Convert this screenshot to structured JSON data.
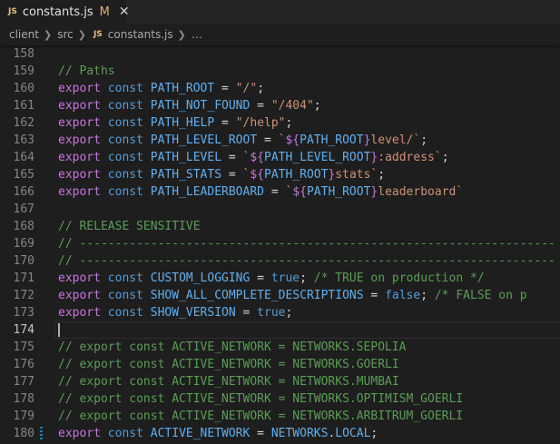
{
  "tab": {
    "badge": "JS",
    "filename": "constants.js",
    "modified": "M",
    "close": "✕"
  },
  "breadcrumb": {
    "items": [
      "client",
      "src"
    ],
    "badge": "JS",
    "file": "constants.js",
    "more": "…"
  },
  "colors": {
    "editor_bg": "#1e1e1e",
    "keyword": "#c678dd",
    "storage": "#569cd6",
    "identifier": "#61afef",
    "string": "#ce9178",
    "comment": "#5c9c57",
    "line_number": "#858585"
  },
  "editor": {
    "active_line": "174",
    "lines": [
      {
        "num": "158",
        "tokens": []
      },
      {
        "num": "159",
        "tokens": [
          {
            "t": "cm",
            "v": "// Paths"
          }
        ]
      },
      {
        "num": "160",
        "tokens": [
          {
            "t": "kw",
            "v": "export"
          },
          {
            "t": "pl",
            "v": " "
          },
          {
            "t": "st",
            "v": "const"
          },
          {
            "t": "pl",
            "v": " "
          },
          {
            "t": "id",
            "v": "PATH_ROOT"
          },
          {
            "t": "pl",
            "v": " = "
          },
          {
            "t": "str",
            "v": "\"/\""
          },
          {
            "t": "pl",
            "v": ";"
          }
        ]
      },
      {
        "num": "161",
        "tokens": [
          {
            "t": "kw",
            "v": "export"
          },
          {
            "t": "pl",
            "v": " "
          },
          {
            "t": "st",
            "v": "const"
          },
          {
            "t": "pl",
            "v": " "
          },
          {
            "t": "id",
            "v": "PATH_NOT_FOUND"
          },
          {
            "t": "pl",
            "v": " = "
          },
          {
            "t": "str",
            "v": "\"/404\""
          },
          {
            "t": "pl",
            "v": ";"
          }
        ]
      },
      {
        "num": "162",
        "tokens": [
          {
            "t": "kw",
            "v": "export"
          },
          {
            "t": "pl",
            "v": " "
          },
          {
            "t": "st",
            "v": "const"
          },
          {
            "t": "pl",
            "v": " "
          },
          {
            "t": "id",
            "v": "PATH_HELP"
          },
          {
            "t": "pl",
            "v": " = "
          },
          {
            "t": "str",
            "v": "\"/help\""
          },
          {
            "t": "pl",
            "v": ";"
          }
        ]
      },
      {
        "num": "163",
        "tokens": [
          {
            "t": "kw",
            "v": "export"
          },
          {
            "t": "pl",
            "v": " "
          },
          {
            "t": "st",
            "v": "const"
          },
          {
            "t": "pl",
            "v": " "
          },
          {
            "t": "id",
            "v": "PATH_LEVEL_ROOT"
          },
          {
            "t": "pl",
            "v": " = "
          },
          {
            "t": "tpl",
            "v": "`"
          },
          {
            "t": "kw",
            "v": "${"
          },
          {
            "t": "id",
            "v": "PATH_ROOT"
          },
          {
            "t": "kw",
            "v": "}"
          },
          {
            "t": "tpl",
            "v": "level/`"
          },
          {
            "t": "pl",
            "v": ";"
          }
        ]
      },
      {
        "num": "164",
        "tokens": [
          {
            "t": "kw",
            "v": "export"
          },
          {
            "t": "pl",
            "v": " "
          },
          {
            "t": "st",
            "v": "const"
          },
          {
            "t": "pl",
            "v": " "
          },
          {
            "t": "id",
            "v": "PATH_LEVEL"
          },
          {
            "t": "pl",
            "v": " = "
          },
          {
            "t": "tpl",
            "v": "`"
          },
          {
            "t": "kw",
            "v": "${"
          },
          {
            "t": "id",
            "v": "PATH_LEVEL_ROOT"
          },
          {
            "t": "kw",
            "v": "}"
          },
          {
            "t": "tpl",
            "v": ":address`"
          },
          {
            "t": "pl",
            "v": ";"
          }
        ]
      },
      {
        "num": "165",
        "tokens": [
          {
            "t": "kw",
            "v": "export"
          },
          {
            "t": "pl",
            "v": " "
          },
          {
            "t": "st",
            "v": "const"
          },
          {
            "t": "pl",
            "v": " "
          },
          {
            "t": "id",
            "v": "PATH_STATS"
          },
          {
            "t": "pl",
            "v": " = "
          },
          {
            "t": "tpl",
            "v": "`"
          },
          {
            "t": "kw",
            "v": "${"
          },
          {
            "t": "id",
            "v": "PATH_ROOT"
          },
          {
            "t": "kw",
            "v": "}"
          },
          {
            "t": "tpl",
            "v": "stats`"
          },
          {
            "t": "pl",
            "v": ";"
          }
        ]
      },
      {
        "num": "166",
        "tokens": [
          {
            "t": "kw",
            "v": "export"
          },
          {
            "t": "pl",
            "v": " "
          },
          {
            "t": "st",
            "v": "const"
          },
          {
            "t": "pl",
            "v": " "
          },
          {
            "t": "id",
            "v": "PATH_LEADERBOARD"
          },
          {
            "t": "pl",
            "v": " = "
          },
          {
            "t": "tpl",
            "v": "`"
          },
          {
            "t": "kw",
            "v": "${"
          },
          {
            "t": "id",
            "v": "PATH_ROOT"
          },
          {
            "t": "kw",
            "v": "}"
          },
          {
            "t": "tpl",
            "v": "leaderboard`"
          }
        ]
      },
      {
        "num": "167",
        "tokens": []
      },
      {
        "num": "168",
        "tokens": [
          {
            "t": "cm",
            "v": "// RELEASE SENSITIVE"
          }
        ]
      },
      {
        "num": "169",
        "tokens": [
          {
            "t": "cm",
            "v": "// -------------------------------------------------------------------"
          }
        ]
      },
      {
        "num": "170",
        "tokens": [
          {
            "t": "cm",
            "v": "// -------------------------------------------------------------------"
          }
        ]
      },
      {
        "num": "171",
        "tokens": [
          {
            "t": "kw",
            "v": "export"
          },
          {
            "t": "pl",
            "v": " "
          },
          {
            "t": "st",
            "v": "const"
          },
          {
            "t": "pl",
            "v": " "
          },
          {
            "t": "id",
            "v": "CUSTOM_LOGGING"
          },
          {
            "t": "pl",
            "v": " = "
          },
          {
            "t": "bl",
            "v": "true"
          },
          {
            "t": "pl",
            "v": "; "
          },
          {
            "t": "cm",
            "v": "/* TRUE on production */"
          }
        ]
      },
      {
        "num": "172",
        "tokens": [
          {
            "t": "kw",
            "v": "export"
          },
          {
            "t": "pl",
            "v": " "
          },
          {
            "t": "st",
            "v": "const"
          },
          {
            "t": "pl",
            "v": " "
          },
          {
            "t": "id",
            "v": "SHOW_ALL_COMPLETE_DESCRIPTIONS"
          },
          {
            "t": "pl",
            "v": " = "
          },
          {
            "t": "bl",
            "v": "false"
          },
          {
            "t": "pl",
            "v": "; "
          },
          {
            "t": "cm",
            "v": "/* FALSE on p"
          }
        ]
      },
      {
        "num": "173",
        "tokens": [
          {
            "t": "kw",
            "v": "export"
          },
          {
            "t": "pl",
            "v": " "
          },
          {
            "t": "st",
            "v": "const"
          },
          {
            "t": "pl",
            "v": " "
          },
          {
            "t": "id",
            "v": "SHOW_VERSION"
          },
          {
            "t": "pl",
            "v": " = "
          },
          {
            "t": "bl",
            "v": "true"
          },
          {
            "t": "pl",
            "v": ";"
          }
        ]
      },
      {
        "num": "174",
        "tokens": []
      },
      {
        "num": "175",
        "tokens": [
          {
            "t": "cm",
            "v": "// export const ACTIVE_NETWORK = NETWORKS.SEPOLIA"
          }
        ]
      },
      {
        "num": "176",
        "tokens": [
          {
            "t": "cm",
            "v": "// export const ACTIVE_NETWORK = NETWORKS.GOERLI"
          }
        ]
      },
      {
        "num": "177",
        "tokens": [
          {
            "t": "cm",
            "v": "// export const ACTIVE_NETWORK = NETWORKS.MUMBAI"
          }
        ]
      },
      {
        "num": "178",
        "tokens": [
          {
            "t": "cm",
            "v": "// export const ACTIVE_NETWORK = NETWORKS.OPTIMISM_GOERLI"
          }
        ]
      },
      {
        "num": "179",
        "tokens": [
          {
            "t": "cm",
            "v": "// export const ACTIVE_NETWORK = NETWORKS.ARBITRUM_GOERLI"
          }
        ]
      },
      {
        "num": "180",
        "modified": true,
        "tokens": [
          {
            "t": "kw",
            "v": "export"
          },
          {
            "t": "pl",
            "v": " "
          },
          {
            "t": "st",
            "v": "const"
          },
          {
            "t": "pl",
            "v": " "
          },
          {
            "t": "id",
            "v": "ACTIVE_NETWORK"
          },
          {
            "t": "pl",
            "v": " = "
          },
          {
            "t": "id",
            "v": "NETWORKS"
          },
          {
            "t": "pl",
            "v": "."
          },
          {
            "t": "id",
            "v": "LOCAL"
          },
          {
            "t": "pl",
            "v": ";"
          }
        ]
      }
    ]
  }
}
